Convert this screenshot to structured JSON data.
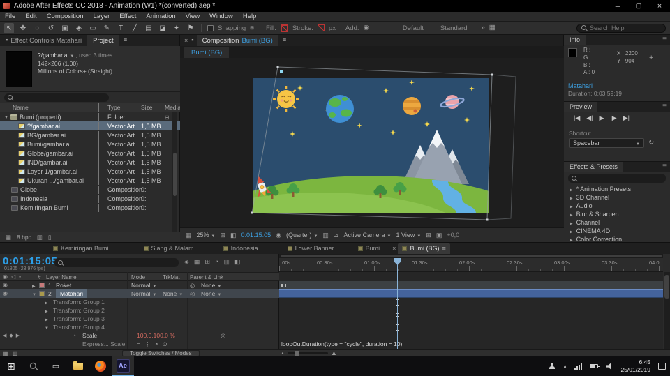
{
  "icons": {
    "menu": "≡",
    "caret_down": "▼",
    "exp_open": "▼",
    "exp_closed": "▶",
    "close": "×",
    "minimize": "─",
    "maximize": "▢",
    "eye": "◉",
    "audio": "◁",
    "lock": "▪",
    "pickwhip": "◎",
    "stopwatch": "◔",
    "reset": "↻",
    "overflow": "»",
    "crosshair": "+"
  },
  "titlebar": {
    "title": "Adobe After Effects CC 2018 - Animation (W1) *(converted).aep *"
  },
  "menubar": {
    "items": [
      "File",
      "Edit",
      "Composition",
      "Layer",
      "Effect",
      "Animation",
      "View",
      "Window",
      "Help"
    ]
  },
  "toolbar": {
    "tools": [
      {
        "name": "selection",
        "glyph": "↖"
      },
      {
        "name": "hand",
        "glyph": "✥"
      },
      {
        "name": "zoom",
        "glyph": "○"
      },
      {
        "name": "rotation",
        "glyph": "↺"
      },
      {
        "name": "camera",
        "glyph": "▣"
      },
      {
        "name": "pan-behind",
        "glyph": "◈"
      },
      {
        "name": "shape",
        "glyph": "▭"
      },
      {
        "name": "pen",
        "glyph": "✎"
      },
      {
        "name": "type",
        "glyph": "T"
      },
      {
        "name": "brush",
        "glyph": "╱"
      },
      {
        "name": "clone-stamp",
        "glyph": "▤"
      },
      {
        "name": "eraser",
        "glyph": "◪"
      },
      {
        "name": "roto-brush",
        "glyph": "✦"
      },
      {
        "name": "puppet",
        "glyph": "⚑"
      }
    ],
    "snapping_label": "Snapping",
    "fill_label": "Fill:",
    "stroke_label": "Stroke:",
    "stroke_value": "px",
    "add_label": "Add:",
    "workspace": [
      "Default",
      "Standard"
    ],
    "search_placeholder": "Search Help"
  },
  "project_panel": {
    "tabs": [
      {
        "label": "Effect Controls Matahari"
      },
      {
        "label": "Project"
      }
    ],
    "preview": {
      "filename": "?/gambar.ai",
      "usage": ", used 3 times",
      "dimensions": "142×206 (1,00)",
      "color_depth": "Millions of Colors+ (Straight)"
    },
    "search_placeholder": "",
    "columns": {
      "name": "Name",
      "type": "Type",
      "size": "Size",
      "media": "Media"
    },
    "items": [
      {
        "name": "Bumi (properti)",
        "type": "Folder",
        "size": ""
      },
      {
        "name": "?/gambar.ai",
        "type": "Vector Art",
        "size": "1,5 MB"
      },
      {
        "name": "BG/gambar.ai",
        "type": "Vector Art",
        "size": "1,5 MB"
      },
      {
        "name": "Bumi/gambar.ai",
        "type": "Vector Art",
        "size": "1,5 MB"
      },
      {
        "name": "Globe/gambar.ai",
        "type": "Vector Art",
        "size": "1,5 MB"
      },
      {
        "name": "IND/gambar.ai",
        "type": "Vector Art",
        "size": "1,5 MB"
      },
      {
        "name": "Layer 1/gambar.ai",
        "type": "Vector Art",
        "size": "1,5 MB"
      },
      {
        "name": "Ukuran .../gambar.ai",
        "type": "Vector Art",
        "size": "1,5 MB"
      },
      {
        "name": "Globe",
        "type": "Composition",
        "size": "0:"
      },
      {
        "name": "Indonesia",
        "type": "Composition",
        "size": "0:"
      },
      {
        "name": "Kemiringan Bumi",
        "type": "Composition",
        "size": "0:"
      }
    ],
    "footer": {
      "bpc": "8 bpc"
    }
  },
  "composition_panel": {
    "title_prefix": "Composition ",
    "comp_name": "Bumi (BG)",
    "tab_label": "Bumi (BG)",
    "zoom": "25%",
    "timecode": "0:01:15:05",
    "resolution": "(Quarter)",
    "camera": "Active Camera",
    "views": "1 View",
    "exposure": "+0,0"
  },
  "info_panel": {
    "title": "Info",
    "r_label": "R :",
    "g_label": "G :",
    "b_label": "B :",
    "a_label": "A :",
    "a_value": "0",
    "x": "X : 2200",
    "y": "Y : 904",
    "layer_name": "Matahari",
    "duration": "Duration: 0:03:59:19"
  },
  "preview_panel": {
    "title": "Preview",
    "transport": [
      "|◀",
      "◀|",
      "▶",
      "|▶",
      "▶|"
    ]
  },
  "shortcut_panel": {
    "label": "Shortcut",
    "value": "Spacebar"
  },
  "effects_panel": {
    "title": "Effects & Presets",
    "search_placeholder": "",
    "categories": [
      "* Animation Presets",
      "3D Channel",
      "Audio",
      "Blur & Sharpen",
      "Channel",
      "CINEMA 4D",
      "Color Correction"
    ]
  },
  "timeline": {
    "tabs": [
      {
        "label": "Kemiringan Bumi"
      },
      {
        "label": "Siang & Malam"
      },
      {
        "label": "Indonesia"
      },
      {
        "label": "Lower Banner"
      },
      {
        "label": "Bumi"
      },
      {
        "label": "Bumi (BG)"
      }
    ],
    "timecode": "0:01:15:05",
    "timecode_detail": "01805 (23,976 fps)",
    "search_placeholder": "",
    "columns": {
      "number": "#",
      "layer_name": "Layer Name",
      "mode": "Mode",
      "trkmat": "TrkMat",
      "parent": "Parent & Link"
    },
    "layers": [
      {
        "number": "1",
        "name": "Roket",
        "mode": "Normal",
        "trkmat": "",
        "parent": "None"
      },
      {
        "number": "2",
        "name": "Matahari",
        "mode": "Normal",
        "trkmat": "None",
        "parent": "None"
      }
    ],
    "groups": [
      {
        "label": "Transform: Group 1"
      },
      {
        "label": "Transform: Group 2"
      },
      {
        "label": "Transform: Group 3"
      },
      {
        "label": "Transform: Group 4"
      }
    ],
    "scale_row": {
      "label": "Scale",
      "value": "100,0,100,0 %"
    },
    "expression_row": {
      "label": "Express... Scale"
    },
    "expression_text": "loopOutDuration(type = \"cycle\", duration = 10)",
    "ruler_labels": [
      ":00s",
      "00:30s",
      "01:00s",
      "01:30s",
      "02:00s",
      "02:30s",
      "03:00s",
      "03:30s",
      "04:0"
    ],
    "footer": {
      "toggle_label": "Toggle Switches / Modes"
    }
  },
  "taskbar": {
    "time": "6:45",
    "date": "25/01/2019"
  }
}
